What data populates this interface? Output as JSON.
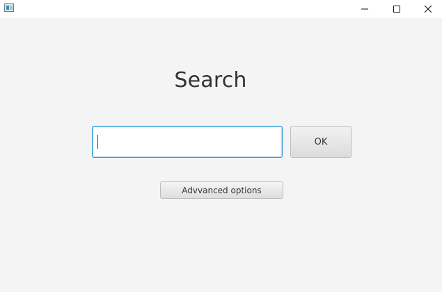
{
  "window": {
    "title": "",
    "controls": {
      "minimize_icon": "minimize-icon",
      "maximize_icon": "maximize-icon",
      "close_icon": "close-icon"
    }
  },
  "main": {
    "title": "Search",
    "search": {
      "value": "",
      "placeholder": ""
    },
    "ok_label": "OK",
    "advanced_label": "Advvanced options"
  },
  "colors": {
    "background": "#f4f4f4",
    "focus_border": "#2d9bd8",
    "text": "#333333"
  }
}
